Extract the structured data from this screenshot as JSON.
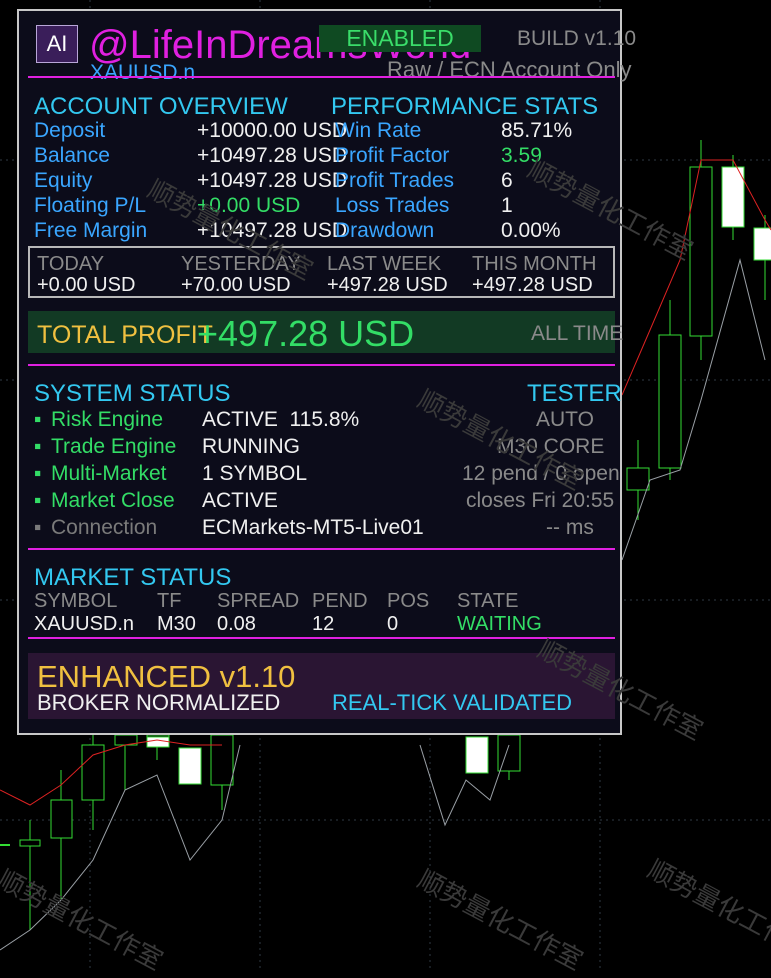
{
  "header": {
    "ai_badge": "AI",
    "brand": "@LifeInDreamsWorld",
    "enabled": "ENABLED",
    "build": "BUILD v1.10",
    "symbol": "XAUUSD.n",
    "account_note": "Raw / ECN Account Only"
  },
  "account": {
    "title": "ACCOUNT OVERVIEW",
    "rows": [
      {
        "label": "Deposit",
        "value": "+10000.00 USD"
      },
      {
        "label": "Balance",
        "value": "+10497.28 USD"
      },
      {
        "label": "Equity",
        "value": "+10497.28 USD"
      },
      {
        "label": "Floating P/L",
        "value": "+0.00 USD"
      },
      {
        "label": "Free Margin",
        "value": "+10497.28 USD"
      }
    ]
  },
  "performance": {
    "title": "PERFORMANCE STATS",
    "rows": [
      {
        "label": "Win Rate",
        "value": "85.71%"
      },
      {
        "label": "Profit Factor",
        "value": "3.59"
      },
      {
        "label": "Profit Trades",
        "value": "6"
      },
      {
        "label": "Loss Trades",
        "value": "1"
      },
      {
        "label": "Drawdown",
        "value": "0.00%"
      }
    ]
  },
  "periods": [
    {
      "label": "TODAY",
      "value": "+0.00 USD"
    },
    {
      "label": "YESTERDAY",
      "value": "+70.00 USD"
    },
    {
      "label": "LAST WEEK",
      "value": "+497.28 USD"
    },
    {
      "label": "THIS MONTH",
      "value": "+497.28 USD"
    }
  ],
  "total": {
    "label": "TOTAL PROFIT",
    "value": "+497.28 USD",
    "period": "ALL TIME"
  },
  "system": {
    "title": "SYSTEM STATUS",
    "tester": "TESTER",
    "rows": [
      {
        "bullet": "▪",
        "label": "Risk Engine",
        "value": "ACTIVE  115.8%",
        "right": "AUTO"
      },
      {
        "bullet": "▪",
        "label": "Trade Engine",
        "value": "RUNNING",
        "right": "M30 CORE"
      },
      {
        "bullet": "▪",
        "label": "Multi-Market",
        "value": "1 SYMBOL",
        "right": "12 pend / 0 open"
      },
      {
        "bullet": "▪",
        "label": "Market Close",
        "value": "ACTIVE",
        "right": "closes Fri 20:55"
      },
      {
        "bullet": "▪",
        "label": "Connection",
        "value": "ECMarkets-MT5-Live01",
        "right": "-- ms"
      }
    ]
  },
  "market": {
    "title": "MARKET STATUS",
    "columns": [
      "SYMBOL",
      "TF",
      "SPREAD",
      "PEND",
      "POS",
      "STATE"
    ],
    "row": [
      "XAUUSD.n",
      "M30",
      "0.08",
      "12",
      "0",
      "WAITING"
    ]
  },
  "footer": {
    "version": "ENHANCED v1.10",
    "broker": "BROKER NORMALIZED",
    "validated": "REAL-TICK VALIDATED"
  },
  "watermark": "顺势量化工作室",
  "colors": {
    "accent": "#e020e0",
    "label_blue": "#3aa6ff",
    "header_cyan": "#33c8f0",
    "positive": "#33dd66",
    "gold": "#f0c040"
  }
}
